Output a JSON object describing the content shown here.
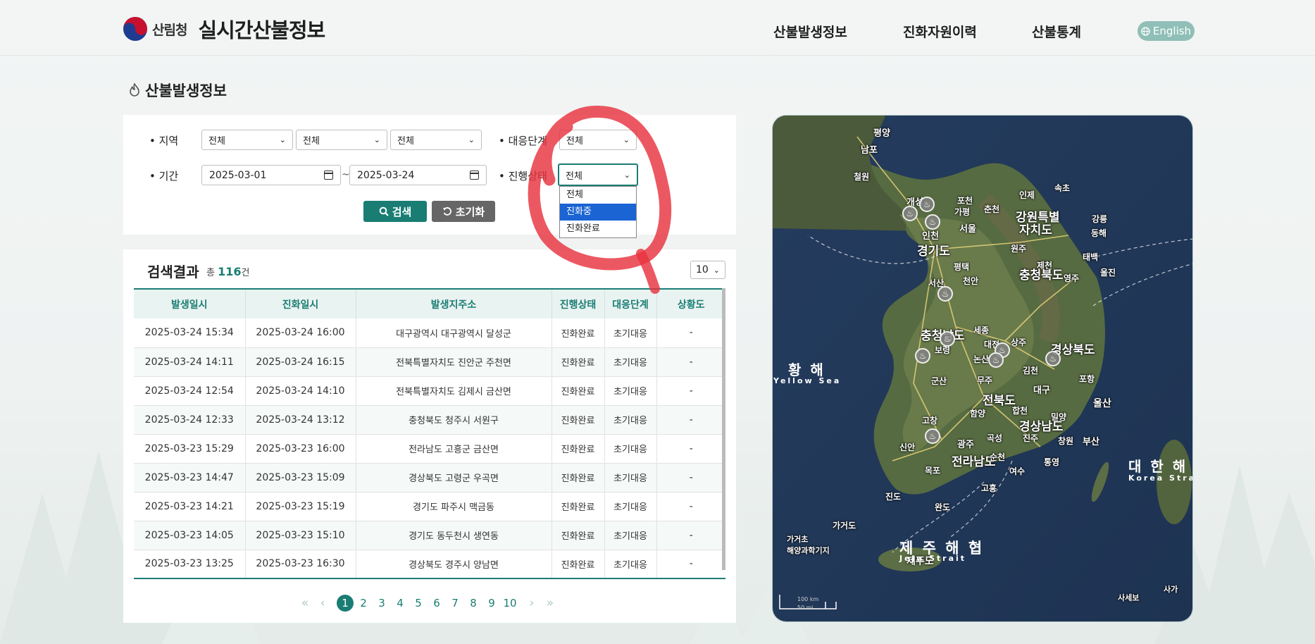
{
  "header": {
    "agency": "산림청",
    "title": "실시간산불정보",
    "nav": [
      "산불발생정보",
      "진화자원이력",
      "산불통계"
    ],
    "lang_button": "English"
  },
  "page_title": "산불발생정보",
  "search": {
    "region_label": "• 지역",
    "region_values": [
      "전체",
      "전체",
      "전체"
    ],
    "response_label": "• 대응단계",
    "response_value": "전체",
    "period_label": "• 기간",
    "date_from": "2025-03-01",
    "date_to": "2025-03-24",
    "date_sep": "~",
    "status_label": "• 진행상태",
    "status_value": "전체",
    "status_options": [
      "전체",
      "진화중",
      "진화완료"
    ],
    "status_highlighted": "진화중",
    "search_button": "검색",
    "reset_button": "초기화"
  },
  "results": {
    "title": "검색결과",
    "count_prefix": "총",
    "count": "116",
    "count_suffix": "건",
    "per_page": "10",
    "columns": [
      "발생일시",
      "진화일시",
      "발생지주소",
      "진행상태",
      "대응단계",
      "상황도"
    ],
    "rows": [
      [
        "2025-03-24 15:34",
        "2025-03-24 16:00",
        "대구광역시 대구광역시 달성군",
        "진화완료",
        "초기대응",
        "-"
      ],
      [
        "2025-03-24 14:11",
        "2025-03-24 16:15",
        "전북특별자치도 진안군 주천면",
        "진화완료",
        "초기대응",
        "-"
      ],
      [
        "2025-03-24 12:54",
        "2025-03-24 14:10",
        "전북특별자치도 김제시 금산면",
        "진화완료",
        "초기대응",
        "-"
      ],
      [
        "2025-03-24 12:33",
        "2025-03-24 13:12",
        "충청북도 청주시 서원구",
        "진화완료",
        "초기대응",
        "-"
      ],
      [
        "2025-03-23 15:29",
        "2025-03-23 16:00",
        "전라남도 고흥군 금산면",
        "진화완료",
        "초기대응",
        "-"
      ],
      [
        "2025-03-23 14:47",
        "2025-03-23 15:09",
        "경상북도 고령군 우곡면",
        "진화완료",
        "초기대응",
        "-"
      ],
      [
        "2025-03-23 14:21",
        "2025-03-23 15:19",
        "경기도 파주시 맥금동",
        "진화완료",
        "초기대응",
        "-"
      ],
      [
        "2025-03-23 14:05",
        "2025-03-23 15:10",
        "경기도 동두천시 생연동",
        "진화완료",
        "초기대응",
        "-"
      ],
      [
        "2025-03-23 13:25",
        "2025-03-23 16:30",
        "경상북도 경주시 양남면",
        "진화완료",
        "초기대응",
        "-"
      ]
    ],
    "pages": [
      "1",
      "2",
      "3",
      "4",
      "5",
      "6",
      "7",
      "8",
      "9",
      "10"
    ],
    "current_page": "1"
  },
  "map": {
    "labels": [
      "평양",
      "남포",
      "철원",
      "개성",
      "포천",
      "가평",
      "춘천",
      "인제",
      "속초",
      "강원특별",
      "자치도",
      "서울",
      "인천",
      "경기도",
      "강릉",
      "동해",
      "원주",
      "평택",
      "제천",
      "태백",
      "충청북도",
      "울진",
      "서산",
      "천안",
      "영주",
      "충청남도",
      "세종",
      "대전",
      "상주",
      "경상북도",
      "보령",
      "논산",
      "김천",
      "군산",
      "무주",
      "대구",
      "포항",
      "전북도",
      "울산",
      "고창",
      "함양",
      "합천",
      "밀양",
      "경상남도",
      "광주",
      "곡성",
      "진주",
      "창원",
      "부산",
      "신안",
      "전라남도",
      "순천",
      "통영",
      "목포",
      "여수",
      "진도",
      "고흥",
      "완도",
      "가거도",
      "가거초\n해양과학기지",
      "제주도",
      "사세보",
      "사가"
    ],
    "seas": [
      "황 해",
      "Yellow Sea",
      "대 한 해 협",
      "Korea Strait",
      "제 주 해 협",
      "Jeju Strait"
    ],
    "scale_km": "100 km",
    "scale_mi": "50 mi"
  }
}
